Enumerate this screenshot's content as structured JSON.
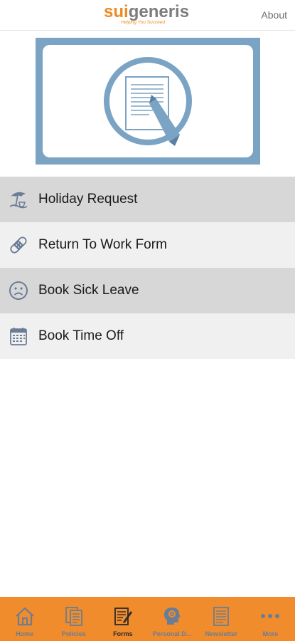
{
  "header": {
    "logo_part1": "sui",
    "logo_part2": "generis",
    "tagline": "Helping You Succeed",
    "about_label": "About"
  },
  "hero": {
    "icon": "document-pencil-icon"
  },
  "menu": {
    "items": [
      {
        "label": "Holiday Request",
        "icon": "beach-umbrella-icon"
      },
      {
        "label": "Return To Work Form",
        "icon": "bandage-icon"
      },
      {
        "label": "Book Sick Leave",
        "icon": "sad-face-icon"
      },
      {
        "label": "Book Time Off",
        "icon": "calendar-icon"
      }
    ]
  },
  "tabbar": {
    "tabs": [
      {
        "label": "Home",
        "icon": "home-icon"
      },
      {
        "label": "Policies",
        "icon": "documents-icon"
      },
      {
        "label": "Forms",
        "icon": "form-edit-icon",
        "active": true
      },
      {
        "label": "Personal D...",
        "icon": "head-gear-icon"
      },
      {
        "label": "Newsletter",
        "icon": "newsletter-icon"
      },
      {
        "label": "More",
        "icon": "more-dots-icon"
      }
    ]
  },
  "colors": {
    "brand_orange": "#f08c2c",
    "icon_blue": "#7ba3c4",
    "row_dark": "#d7d7d7",
    "row_light": "#f0f0f0"
  }
}
